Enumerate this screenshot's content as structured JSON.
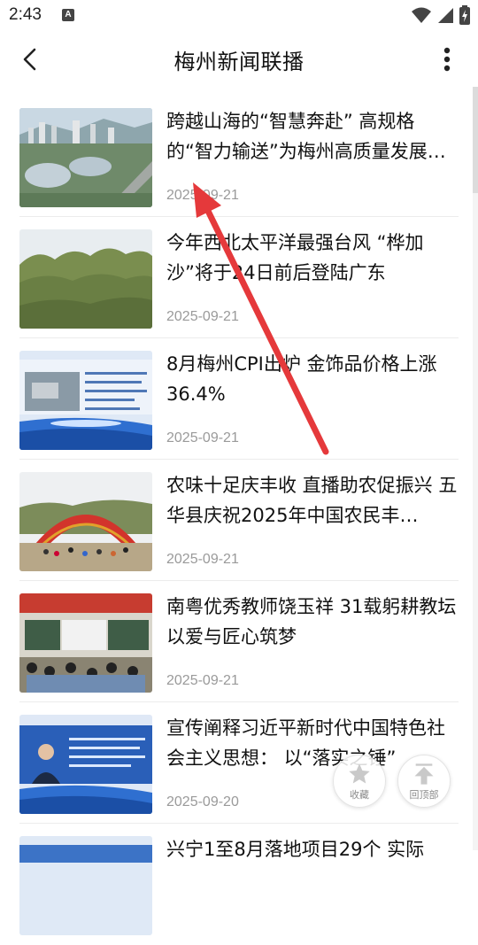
{
  "status_bar": {
    "time": "2:43",
    "notification_glyph": "A",
    "icons": [
      "wifi-icon",
      "cell-signal-icon",
      "battery-charging-icon"
    ]
  },
  "header": {
    "title": "梅州新闻联播",
    "back_icon": "chevron-left-icon",
    "more_icon": "more-vertical-icon"
  },
  "news": [
    {
      "title": "跨越山海的“智慧奔赴” 高规格的“智力输送”为梅州高质量发展…",
      "date": "2025-09-21",
      "thumb": "city-stadium-aerial"
    },
    {
      "title": "今年西北太平洋最强台风 “桦加沙”将于24日前后登陆广东",
      "date": "2025-09-21",
      "thumb": "trees-under-sky"
    },
    {
      "title": "8月梅州CPI出炉 金饰品价格上涨36.4%",
      "date": "2025-09-21",
      "thumb": "news-graphic-blue"
    },
    {
      "title": "农味十足庆丰收 直播助农促振兴 五华县庆祝2025年中国农民丰…",
      "date": "2025-09-21",
      "thumb": "harvest-festival-arch"
    },
    {
      "title": "南粤优秀教师饶玉祥 31载躬耕教坛 以爱与匠心筑梦",
      "date": "2025-09-21",
      "thumb": "classroom"
    },
    {
      "title": "宣传阐释习近平新时代中国特色社会主义思想： 以“落实之锤”",
      "date": "2025-09-20",
      "thumb": "news-anchor"
    },
    {
      "title": "兴宁1至8月落地项目29个 实际",
      "date": "",
      "thumb": "news-graphic-blue-2"
    }
  ],
  "fab": {
    "favorite_label": "收藏",
    "back_to_top_label": "回顶部"
  },
  "annotation": {
    "type": "red-arrow",
    "color": "#e5393b"
  }
}
